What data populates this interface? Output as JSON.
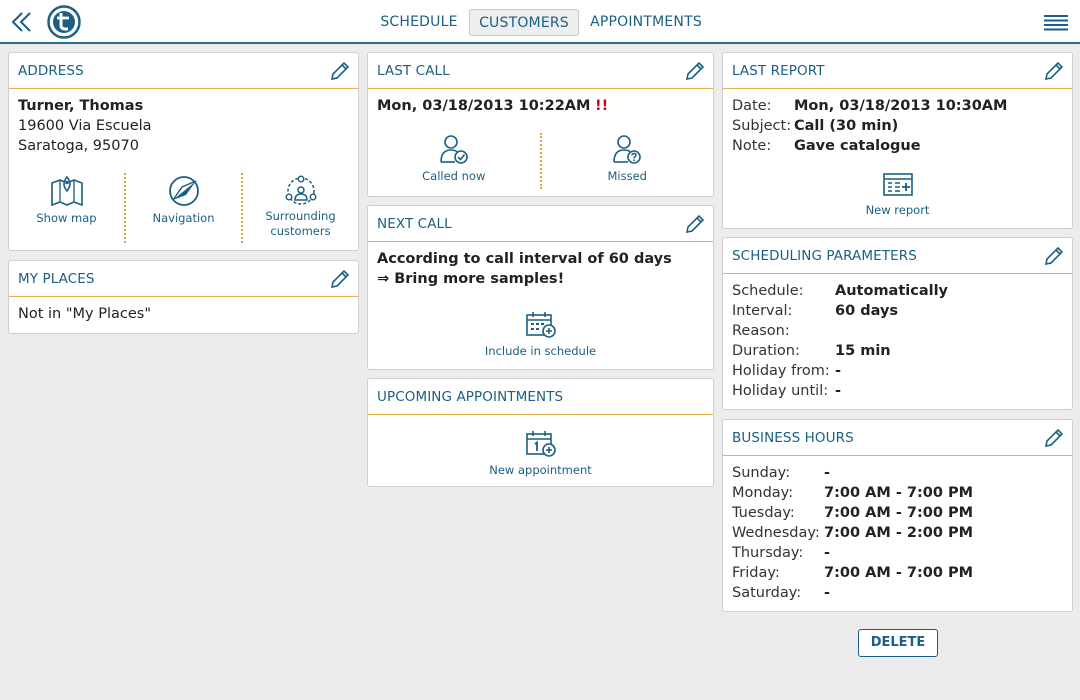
{
  "nav": {
    "tabs": [
      {
        "label": "SCHEDULE"
      },
      {
        "label": "CUSTOMERS"
      },
      {
        "label": "APPOINTMENTS"
      }
    ]
  },
  "address": {
    "title": "ADDRESS",
    "name": "Turner, Thomas",
    "street": "19600 Via Escuela",
    "city": "Saratoga, 95070",
    "actions": {
      "show_map": "Show map",
      "navigation": "Navigation",
      "surrounding_1": "Surrounding",
      "surrounding_2": "customers"
    }
  },
  "my_places": {
    "title": "MY PLACES",
    "text": "Not in \"My Places\""
  },
  "last_call": {
    "title": "LAST CALL",
    "datetime": "Mon, 03/18/2013 10:22AM",
    "warning": "!!",
    "actions": {
      "called_now": "Called now",
      "missed": "Missed"
    }
  },
  "next_call": {
    "title": "NEXT CALL",
    "line1": "According to call interval of 60 days",
    "line2": "⇒ Bring more samples!",
    "action": "Include in schedule"
  },
  "upcoming": {
    "title": "UPCOMING APPOINTMENTS",
    "action": "New appointment"
  },
  "last_report": {
    "title": "LAST REPORT",
    "rows": [
      {
        "k": "Date:",
        "v": "Mon, 03/18/2013 10:30AM"
      },
      {
        "k": "Subject:",
        "v": "Call (30 min)"
      },
      {
        "k": "Note:",
        "v": "Gave catalogue"
      }
    ],
    "action": "New report"
  },
  "scheduling": {
    "title": "SCHEDULING PARAMETERS",
    "rows": [
      {
        "k": "Schedule:",
        "v": "Automatically"
      },
      {
        "k": "Interval:",
        "v": "60 days"
      },
      {
        "k": "Reason:",
        "v": ""
      },
      {
        "k": "Duration:",
        "v": "15 min"
      },
      {
        "k": "Holiday from:",
        "v": "-"
      },
      {
        "k": "Holiday until:",
        "v": "-"
      }
    ]
  },
  "business_hours": {
    "title": "BUSINESS HOURS",
    "rows": [
      {
        "k": "Sunday:",
        "v": "-"
      },
      {
        "k": "Monday:",
        "v": "7:00 AM - 7:00 PM"
      },
      {
        "k": "Tuesday:",
        "v": "7:00 AM - 7:00 PM"
      },
      {
        "k": "Wednesday:",
        "v": "7:00 AM - 2:00 PM"
      },
      {
        "k": "Thursday:",
        "v": "-"
      },
      {
        "k": "Friday:",
        "v": "7:00 AM - 7:00 PM"
      },
      {
        "k": "Saturday:",
        "v": "-"
      }
    ]
  },
  "delete_label": "DELETE",
  "colors": {
    "accent": "#1b5f82",
    "divider": "#e2b54a",
    "warning": "#d0021b",
    "background": "#ececec"
  },
  "icons": [
    "double-chevron-left-icon",
    "app-logo-icon",
    "hamburger-menu-icon",
    "pencil-edit-icon",
    "map-icon",
    "compass-icon",
    "people-radius-icon",
    "user-check-icon",
    "user-question-icon",
    "calendar-add-icon",
    "report-add-icon"
  ]
}
